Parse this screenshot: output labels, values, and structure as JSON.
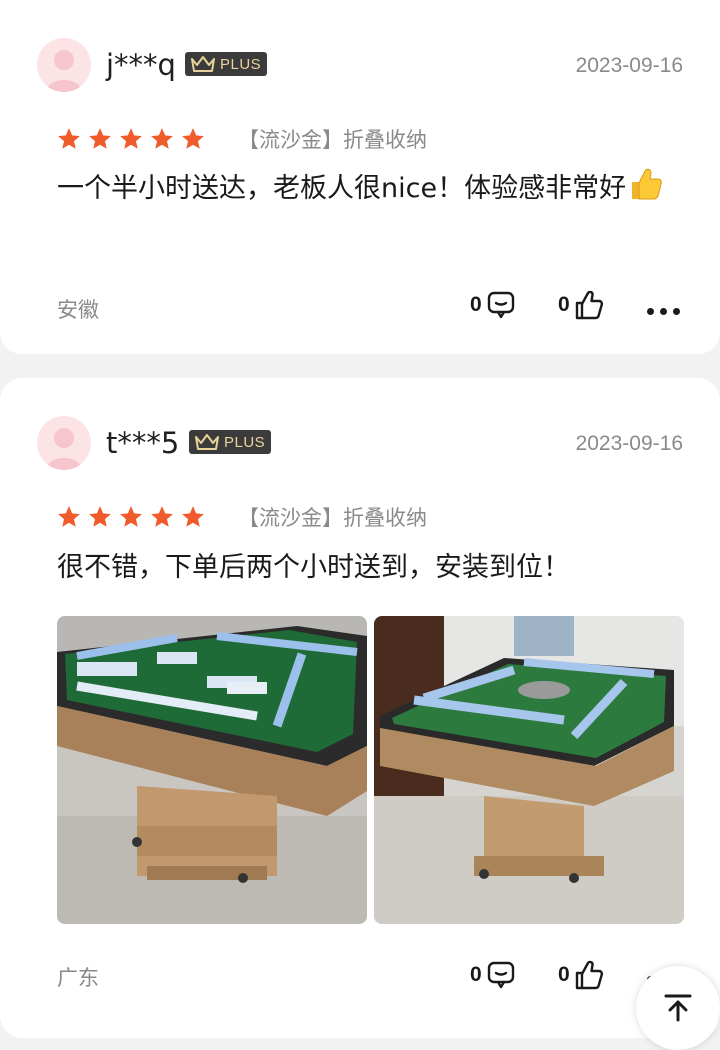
{
  "reviews": [
    {
      "username": "j***q",
      "badge": "PLUS",
      "date": "2023-09-16",
      "rating": 5,
      "spec": "【流沙金】折叠收纳",
      "content": "一个半小时送达，老板人很nice！体验感非常好",
      "content_emoji": "thumbs-up",
      "location": "安徽",
      "comment_count": "0",
      "like_count": "0"
    },
    {
      "username": "t***5",
      "badge": "PLUS",
      "date": "2023-09-16",
      "rating": 5,
      "spec": "【流沙金】折叠收纳",
      "content": "很不错，下单后两个小时送到，安装到位！",
      "location": "广东",
      "comment_count": "0",
      "like_count": "0",
      "photos": [
        "mahjong-table-photo-1",
        "mahjong-table-photo-2"
      ]
    }
  ],
  "colors": {
    "star": "#f05b2c",
    "badge_bg": "#3b3b3b",
    "badge_text": "#e8d39a",
    "muted_text": "#8a8a8a",
    "avatar_bg": "#fbe3e6"
  }
}
